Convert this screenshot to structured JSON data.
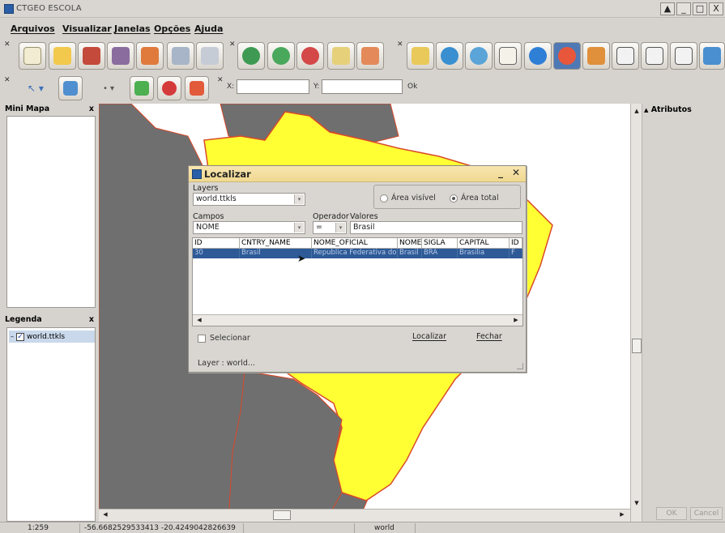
{
  "window": {
    "title": "CTGEO ESCOLA",
    "buttons": [
      "▲",
      "_",
      "□",
      "X"
    ]
  },
  "menu": [
    "Arquivos",
    "Visualizar",
    "Janelas",
    "Opções",
    "Ajuda"
  ],
  "toolbar": {
    "coord_x_label": "X:",
    "coord_y_label": "Y:",
    "ok_label": "Ok",
    "coord_x_value": "",
    "coord_y_value": ""
  },
  "panels": {
    "minimap_title": "Mini Mapa",
    "legend_title": "Legenda",
    "legend_layer": "world.ttkls",
    "attributes_title": "Atributos",
    "close_glyph": "x"
  },
  "attributes": {
    "ok": "OK",
    "cancel": "Cancel"
  },
  "dialog": {
    "title": "Localizar",
    "layers_label": "Layers",
    "layer_value": "world.ttkls",
    "area_visible": "Área visível",
    "area_total": "Área total",
    "area_selected": "total",
    "campos_label": "Campos",
    "campos_value": "NOME",
    "operador_label": "Operador",
    "operador_value": "=",
    "valores_label": "Valores",
    "valores_value": "Brasil",
    "columns": [
      "ID",
      "CNTRY_NAME",
      "NOME_OFICIAL",
      "NOME",
      "SIGLA",
      "CAPITAL",
      "ID"
    ],
    "row": [
      "30",
      "Brasil",
      "Republica Federativa do",
      "Brasil",
      "BRA",
      "Brasilia",
      "F"
    ],
    "selecionar": "Selecionar",
    "localizar_btn": "Localizar",
    "fechar_btn": "Fechar",
    "footer": "Layer :  world..."
  },
  "status": {
    "scale": "1:259",
    "coords": "-56.6682529533413 -20.4249042826639",
    "layer": "world"
  },
  "colors": {
    "brazil_fill": "#ffff33",
    "brazil_border": "#d94a2a",
    "country_fill": "#6f6f70",
    "selection": "#2e5a97"
  }
}
